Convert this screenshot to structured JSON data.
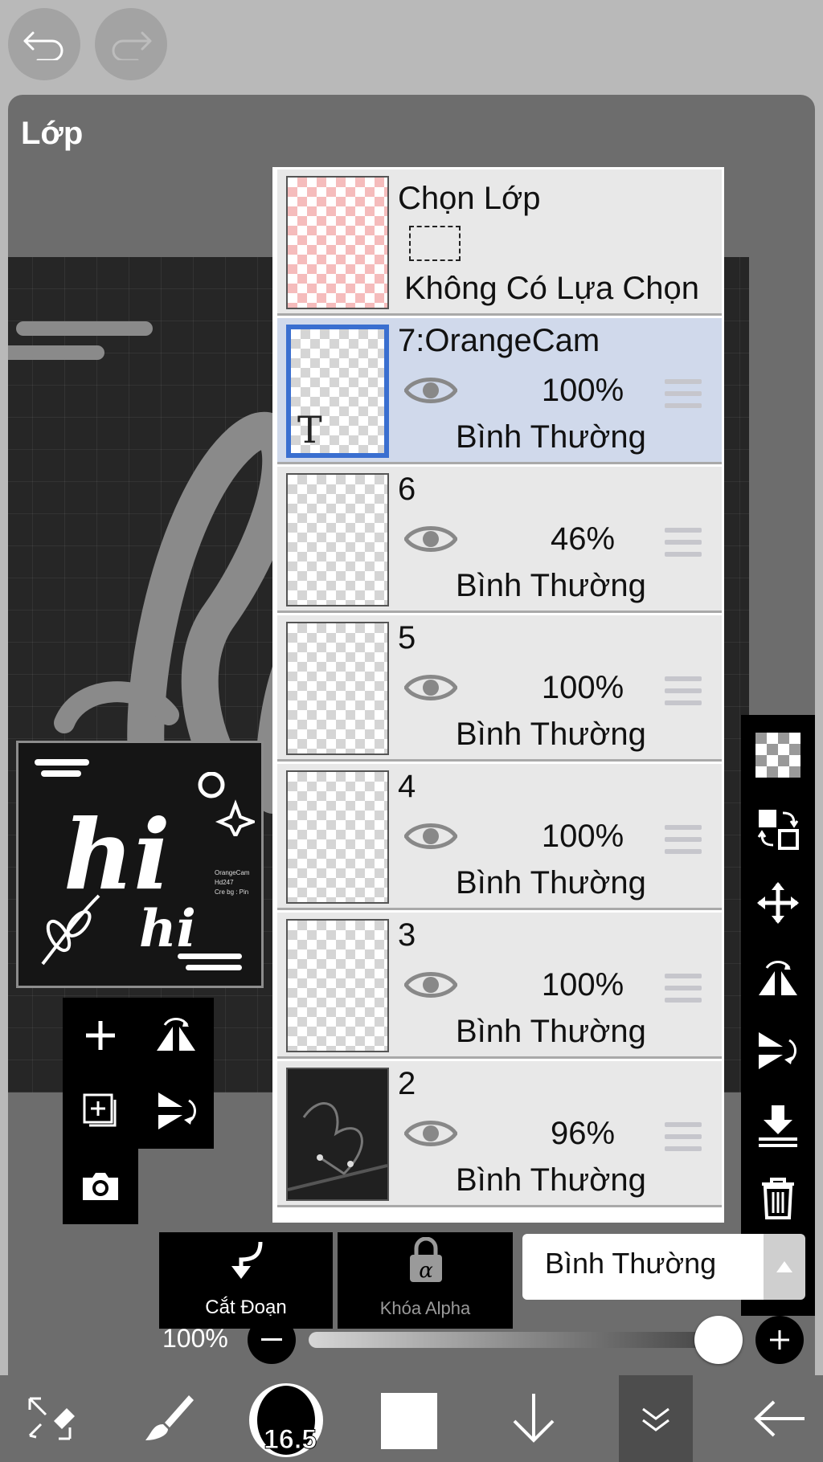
{
  "panel": {
    "title": "Lớp"
  },
  "selection_row": {
    "label": "Chọn Lớp",
    "status": "Không Có Lựa Chọn"
  },
  "layers": [
    {
      "name": "7:OrangeCam",
      "opacity": "100%",
      "blend": "Bình Thường",
      "selected": true,
      "thumb_text": "T"
    },
    {
      "name": "6",
      "opacity": "46%",
      "blend": "Bình Thường",
      "selected": false
    },
    {
      "name": "5",
      "opacity": "100%",
      "blend": "Bình Thường",
      "selected": false
    },
    {
      "name": "4",
      "opacity": "100%",
      "blend": "Bình Thường",
      "selected": false
    },
    {
      "name": "3",
      "opacity": "100%",
      "blend": "Bình Thường",
      "selected": false
    },
    {
      "name": "2",
      "opacity": "96%",
      "blend": "Bình Thường",
      "selected": false
    }
  ],
  "preview": {
    "big_text": "hi",
    "small_text": "hi",
    "caption_lines": [
      "OrangeCam",
      "Hd247",
      "Cre bg : Pin"
    ]
  },
  "bottom_controls": {
    "cut_label": "Cắt Đoạn",
    "alpha_lock_label": "Khóa Alpha",
    "blend_mode": "Bình Thường",
    "opacity_label": "100%",
    "opacity_value": 1.0
  },
  "brush": {
    "size": "16.5"
  },
  "colors": {
    "panel_bg": "#6d6d6d",
    "selected_row": "#d0d9eb",
    "selected_border": "#3a6fd0"
  }
}
